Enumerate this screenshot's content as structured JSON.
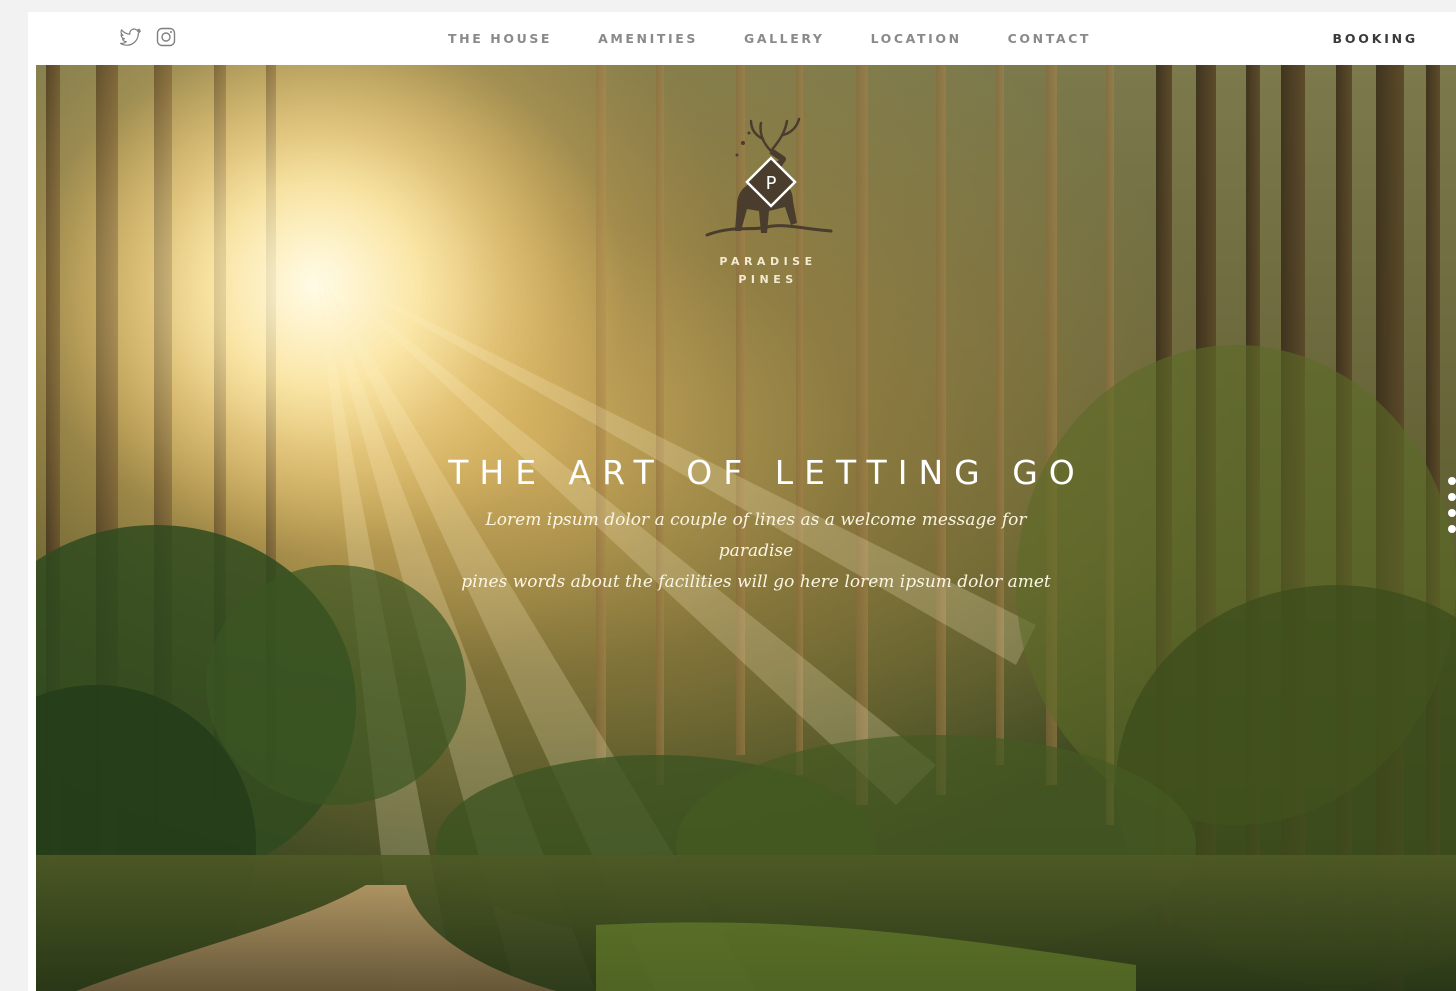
{
  "social": {
    "twitter_icon": "twitter-icon",
    "instagram_icon": "instagram-icon"
  },
  "nav": {
    "items": [
      {
        "label": "THE HOUSE"
      },
      {
        "label": "AMENITIES"
      },
      {
        "label": "GALLERY"
      },
      {
        "label": "LOCATION"
      },
      {
        "label": "CONTACT"
      }
    ],
    "booking_label": "BOOKING"
  },
  "hero": {
    "brand_line1": "PARADISE",
    "brand_line2": "PINES",
    "logo_letter": "P",
    "headline": "THE ART OF LETTING GO",
    "tagline_line1": "Lorem ipsum dolor a couple of lines as a welcome message for paradise",
    "tagline_line2": "pines words about the facilities will go here lorem ipsum dolor amet"
  },
  "colors": {
    "nav_text": "#8a8a8a",
    "booking_text": "#3a3a3a",
    "brand_text": "#f4ead0",
    "logo_dark": "#4a3d2e"
  }
}
